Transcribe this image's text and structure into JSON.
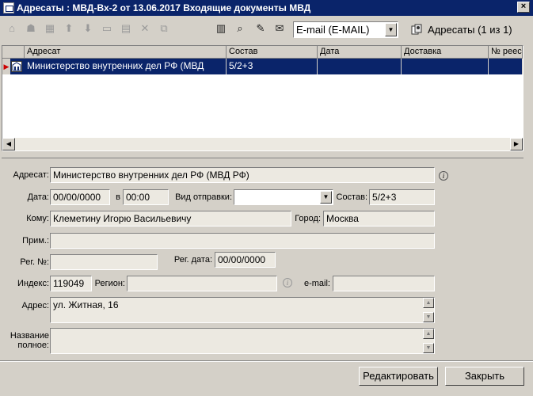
{
  "window": {
    "title": "Адресаты : МВД-Вх-2 от 13.06.2017 Входящие документы МВД",
    "close_label": "×"
  },
  "toolbar": {
    "delivery_combo": "E-mail (E-MAIL)",
    "addressees_button": "Адресаты (1 из 1)"
  },
  "grid": {
    "columns": [
      "Адресат",
      "Состав",
      "Дата",
      "Доставка",
      "№ реес"
    ],
    "rows": [
      {
        "addressee": "Министерство внутренних дел РФ (МВД",
        "composition": "5/2+3",
        "date": "",
        "delivery": "",
        "reg_no": ""
      }
    ]
  },
  "form": {
    "addressee_label": "Адресат:",
    "addressee_value": "Министерство внутренних дел РФ (МВД РФ)",
    "date_label": "Дата:",
    "date_value": "00/00/0000",
    "at_label": "в",
    "time_value": "00:00",
    "send_type_label": "Вид отправки:",
    "send_type_value": "",
    "composition_label": "Состав:",
    "composition_value": "5/2+3",
    "to_label": "Кому:",
    "to_value": "Клеметину Игорю Васильевичу",
    "city_label": "Город:",
    "city_value": "Москва",
    "note_label": "Прим.:",
    "note_value": "",
    "reg_no_label": "Рег. №:",
    "reg_no_value": "",
    "reg_date_label": "Рег. дата:",
    "reg_date_value": "00/00/0000",
    "index_label": "Индекс:",
    "index_value": "119049",
    "region_label": "Регион:",
    "region_value": "",
    "email_label": "e-mail:",
    "email_value": "",
    "address_label": "Адрес:",
    "address_value": "ул. Житная, 16",
    "full_name_label_1": "Название",
    "full_name_label_2": "полное:",
    "full_name_value": ""
  },
  "buttons": {
    "edit": "Редактировать",
    "close": "Закрыть"
  }
}
